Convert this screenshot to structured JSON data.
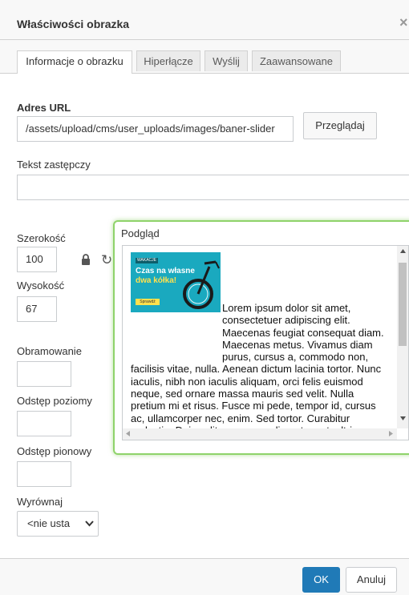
{
  "dialog": {
    "title": "Właściwości obrazka",
    "close_icon": "close-icon",
    "close_glyph": "×"
  },
  "tabs": [
    {
      "label": "Informacje o obrazku",
      "active": true
    },
    {
      "label": "Hiperłącze",
      "active": false
    },
    {
      "label": "Wyślij",
      "active": false
    },
    {
      "label": "Zaawansowane",
      "active": false
    }
  ],
  "url": {
    "label": "Adres URL",
    "value": "/assets/upload/cms/user_uploads/images/baner-slider",
    "browse_label": "Przeglądaj"
  },
  "alt": {
    "label": "Tekst zastępczy",
    "value": ""
  },
  "width": {
    "label": "Szerokość",
    "value": "100"
  },
  "height": {
    "label": "Wysokość",
    "value": "67"
  },
  "ratio_lock_icon": "lock-icon",
  "reset_size_icon": "reset-icon",
  "reset_glyph": "↻",
  "border": {
    "label": "Obramowanie",
    "value": ""
  },
  "hspace": {
    "label": "Odstęp poziomy",
    "value": ""
  },
  "vspace": {
    "label": "Odstęp pionowy",
    "value": ""
  },
  "align": {
    "label": "Wyrównaj",
    "selected": "<nie usta"
  },
  "preview": {
    "label": "Podgląd",
    "banner": {
      "tag": "WAKACJE",
      "headline_1": "Czas na własne",
      "headline_2": "dwa kółka!",
      "button": "Sprawdź"
    },
    "text": "Lorem ipsum dolor sit amet, consectetuer adipiscing elit. Maecenas feugiat consequat diam. Maecenas metus. Vivamus diam purus, cursus a, commodo non, facilisis vitae, nulla. Aenean dictum lacinia tortor. Nunc iaculis, nibh non iaculis aliquam, orci felis euismod neque, sed ornare massa mauris sed velit. Nulla pretium mi et risus. Fusce mi pede, tempor id, cursus ac, ullamcorper nec, enim. Sed tortor. Curabitur molestie. Duis velit augue, condimentum at, ultrices a, luctus ut, orci."
  },
  "footer": {
    "ok_label": "OK",
    "cancel_label": "Anuluj"
  },
  "colors": {
    "primary": "#207ab7",
    "highlight": "#8fd36a",
    "banner": "#1aa9bf"
  }
}
